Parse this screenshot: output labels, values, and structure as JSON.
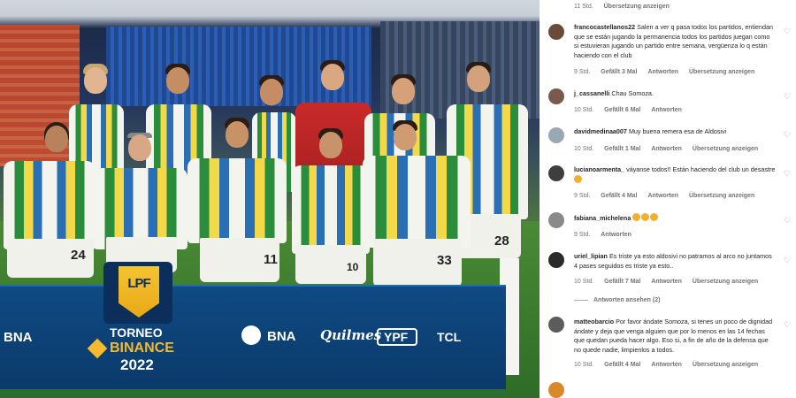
{
  "banner": {
    "lpf_mark": "LPF",
    "torneo": "TORNEO",
    "binance": "BINANCE",
    "year": "2022",
    "sponsor_bna_left": "BNA",
    "sponsor_bna_right": "BNA",
    "sponsor_quilmes": "Quilmes",
    "sponsor_ypf": "YPF",
    "sponsor_tcl": "TCL"
  },
  "jersey_numbers": [
    "24",
    "11",
    "33",
    "28",
    "10"
  ],
  "colors": {
    "accent_text": "#262626",
    "meta_text": "#737373",
    "banner_blue": "#0f4a82"
  },
  "top_meta": {
    "time": "11 Std.",
    "translate": "Übersetzung anzeigen"
  },
  "comments": [
    {
      "username": "francocastellanos22",
      "text": "Salen a ver q pasa todos los partidos, entiendan que se están jugando la permanencia todos los partidos juegan como si estuvieran jugando un partido entre semana, vergüenza lo q están haciendo con el club",
      "time": "9 Std.",
      "likes": "Gefällt 3 Mal",
      "reply": "Antworten",
      "translate": "Übersetzung anzeigen",
      "avatar_color": "#6b4a3a"
    },
    {
      "username": "j_cassanelli",
      "text": "Chau Somoza.",
      "time": "10 Std.",
      "likes": "Gefällt 6 Mal",
      "reply": "Antworten",
      "translate": "",
      "avatar_color": "#7a5a4a"
    },
    {
      "username": "davidmedinaa007",
      "text": "Muy buena remera esa de Aldosivi",
      "time": "10 Std.",
      "likes": "Gefällt 1 Mal",
      "reply": "Antworten",
      "translate": "Übersetzung anzeigen",
      "avatar_color": "#9aa8b4"
    },
    {
      "username": "lucianoarmenta_",
      "text": "váyanse todos!! Están haciendo del club un desastre",
      "time": "9 Std.",
      "likes": "Gefällt 4 Mal",
      "reply": "Antworten",
      "translate": "Übersetzung anzeigen",
      "avatar_color": "#3e3e3e"
    },
    {
      "username": "fabiana_michelena",
      "text": "",
      "time": "9 Std.",
      "likes": "",
      "reply": "Antworten",
      "translate": "",
      "avatar_color": "#8a8a8a"
    },
    {
      "username": "uriel_lipian",
      "text": "Es triste ya esto aldosivi no patramos al arco no juntamos 4 pases seguidos es triste ya esto..",
      "time": "10 Std.",
      "likes": "Gefällt 7 Mal",
      "reply": "Antworten",
      "translate": "Übersetzung anzeigen",
      "avatar_color": "#2b2b2b",
      "replies": "Antworten ansehen (2)"
    },
    {
      "username": "matteobarcio",
      "text": "Por favor ándate Somoza, si tenes un poco de dignidad ándate y deja que venga alguien que por lo menos en las 14 fechas que quedan pueda hacer algo. Eso si, a fin de año de la defensa que no quede nadie, limpienlos a todos.",
      "time": "10 Std.",
      "likes": "Gefällt 4 Mal",
      "reply": "Antworten",
      "translate": "Übersetzung anzeigen",
      "avatar_color": "#5c5c5c"
    }
  ]
}
